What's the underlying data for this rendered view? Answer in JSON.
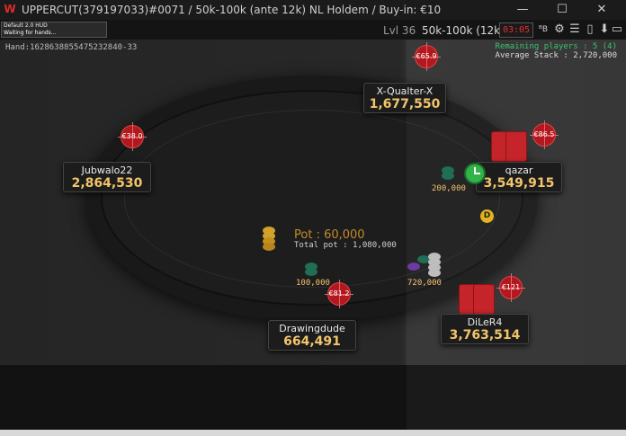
{
  "window": {
    "title": "UPPERCUT(379197033)#0071 / 50k-100k (ante 12k) NL Holdem / Buy-in: €10",
    "minimize_label": "—",
    "maximize_label": "☐",
    "close_label": "✕"
  },
  "toolbar": {
    "hud_title": "Default 2.0 HUD",
    "hud_status": "Waiting for hands...",
    "level": "Lvl 36",
    "blinds": "50k-100k (12k)",
    "timer": "03:05"
  },
  "info": {
    "hand_id": "Hand:1628638855475232840-33",
    "remaining_players": "Remaining players : 5 (4)",
    "average_stack": "Average Stack : 2,720,000"
  },
  "pot": {
    "label": "Pot : 60,000",
    "total": "Total pot : 1,080,000"
  },
  "dealer_button": "D",
  "players": [
    {
      "name": "X-Qualter-X",
      "stack": "1,677,550",
      "bounty": "€65.9"
    },
    {
      "name": "Jubwalo22",
      "stack": "2,864,530",
      "bounty": "€38.0"
    },
    {
      "name": "qazar",
      "stack": "3,549,915",
      "bounty": "€86.5",
      "bet": "200,000"
    },
    {
      "name": "Drawingdude",
      "stack": "664,491",
      "bounty": "€81.2",
      "bet": "100,000"
    },
    {
      "name": "DiLeR4",
      "stack": "3,763,514",
      "bounty": "€121",
      "bet": "720,000"
    }
  ],
  "colors": {
    "bounty_red": "#b3181f",
    "stack_gold": "#f2c46b",
    "remaining_green": "#39c46b",
    "card_back_red": "#c4242a",
    "dealer_yellow": "#e3b21c"
  }
}
